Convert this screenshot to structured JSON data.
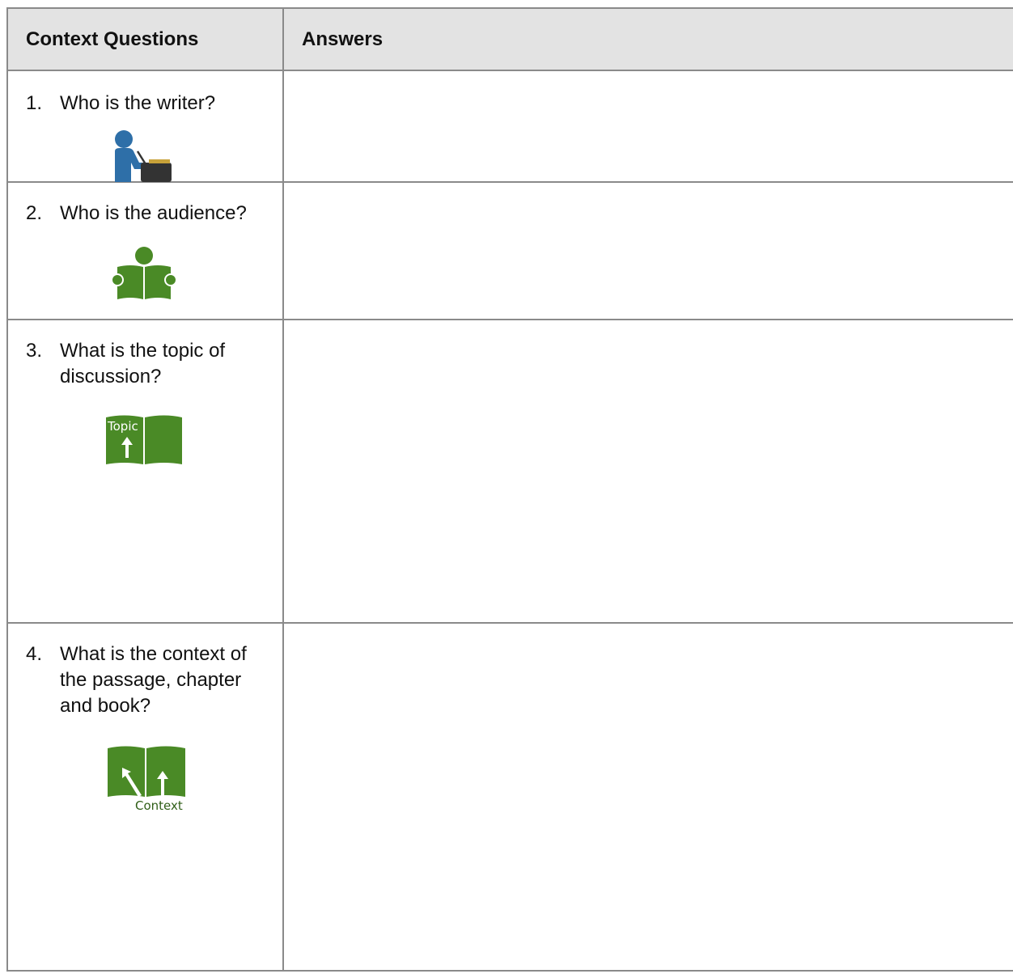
{
  "header": {
    "questions_label": "Context Questions",
    "answers_label": "Answers"
  },
  "rows": [
    {
      "number": "1.",
      "question": "Who is the writer?",
      "icon": "writer-at-desk-icon",
      "answer": ""
    },
    {
      "number": "2.",
      "question": "Who is the audience?",
      "icon": "reader-with-book-icon",
      "answer": ""
    },
    {
      "number": "3.",
      "question": "What is the topic of discussion?",
      "icon": "topic-book-icon",
      "icon_label": "Topic",
      "answer": ""
    },
    {
      "number": "4.",
      "question": "What is the context of the passage, chapter and book?",
      "icon": "context-book-icon",
      "icon_label": "Context",
      "answer": ""
    }
  ],
  "colors": {
    "header_bg": "#e3e3e3",
    "border": "#8a8a8a",
    "writer_blue": "#2e6fa8",
    "book_green": "#4a8a26",
    "context_text": "#2f5e17"
  }
}
